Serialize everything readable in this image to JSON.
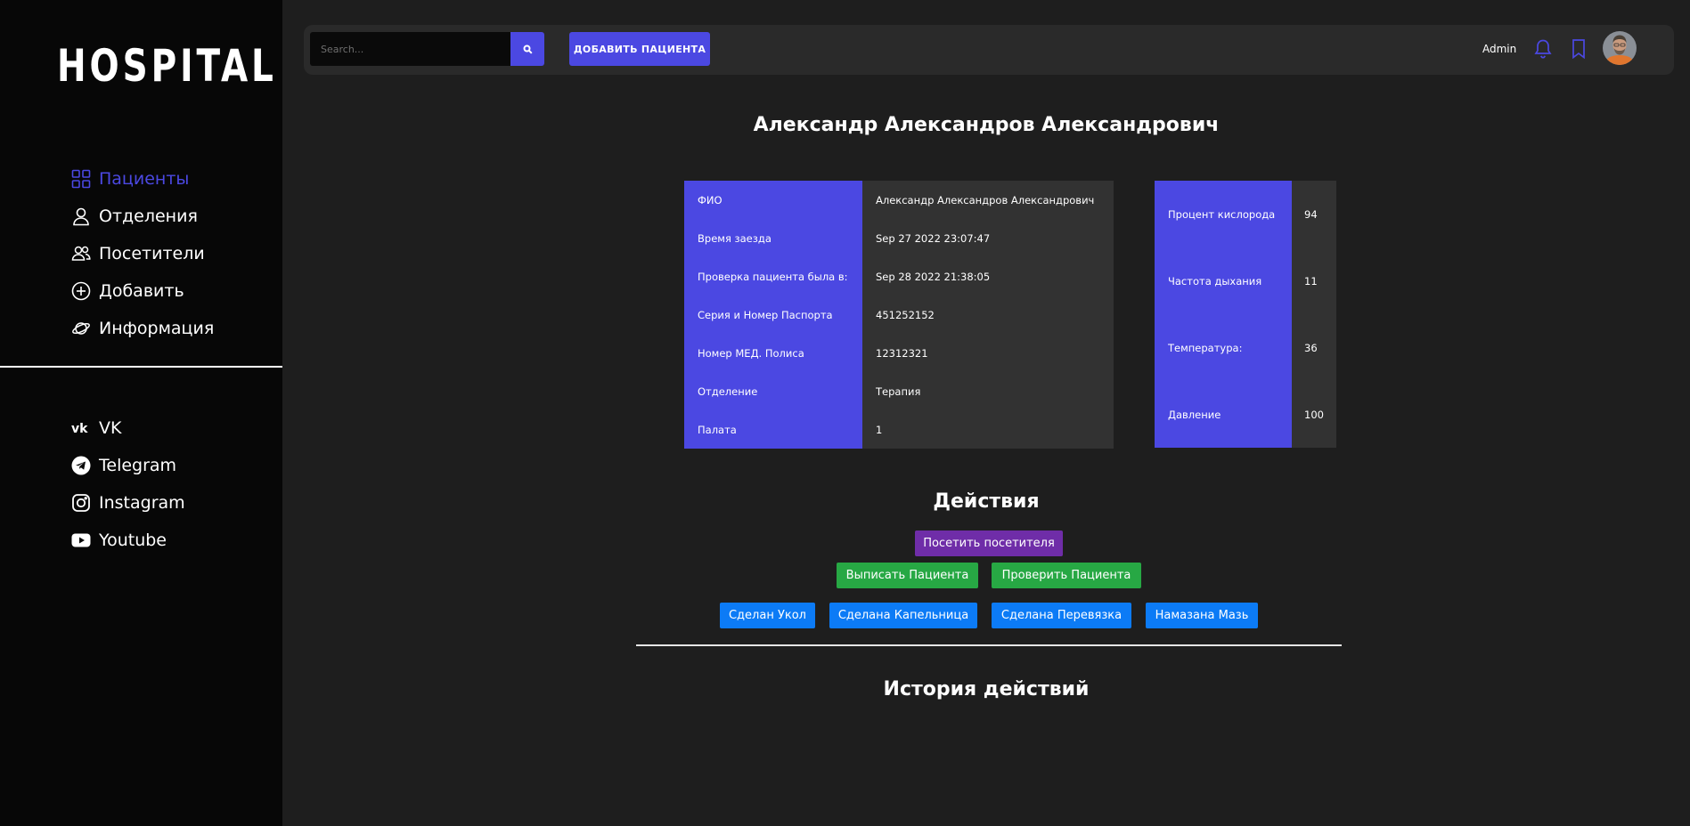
{
  "sidebar": {
    "logo": "HOSPITAL",
    "nav": [
      {
        "label": "Пациенты",
        "icon": "grid-icon",
        "active": true
      },
      {
        "label": "Отделения",
        "icon": "user-icon",
        "active": false
      },
      {
        "label": "Посетители",
        "icon": "users-icon",
        "active": false
      },
      {
        "label": "Добавить",
        "icon": "plus-circle-icon",
        "active": false
      },
      {
        "label": "Информация",
        "icon": "planet-icon",
        "active": false
      }
    ],
    "social": [
      {
        "label": "VK",
        "icon": "vk-icon"
      },
      {
        "label": "Telegram",
        "icon": "telegram-icon"
      },
      {
        "label": "Instagram",
        "icon": "instagram-icon"
      },
      {
        "label": "Youtube",
        "icon": "youtube-icon"
      }
    ]
  },
  "topbar": {
    "search_placeholder": "Search...",
    "add_patient_label": "ДОБАВИТЬ ПАЦИЕНТА",
    "user_name": "Admin"
  },
  "patient": {
    "title": "Александр Александров Александрович",
    "info": [
      {
        "key": "ФИО",
        "value": "Александр Александров Александрович"
      },
      {
        "key": "Время заезда",
        "value": "Sep 27 2022 23:07:47"
      },
      {
        "key": "Проверка пациента была в:",
        "value": "Sep 28 2022 21:38:05"
      },
      {
        "key": "Серия и Номер Паспорта",
        "value": "451252152"
      },
      {
        "key": "Номер МЕД. Полиса",
        "value": "12312321"
      },
      {
        "key": "Отделение",
        "value": "Терапия"
      },
      {
        "key": "Палата",
        "value": "1"
      }
    ],
    "vitals": [
      {
        "key": "Процент кислорода",
        "value": "94"
      },
      {
        "key": "Частота дыхания",
        "value": "11"
      },
      {
        "key": "Температура:",
        "value": "36"
      },
      {
        "key": "Давление",
        "value": "100"
      }
    ]
  },
  "actions": {
    "title": "Действия",
    "visit_label": "Посетить посетителя",
    "discharge_label": "Выписать Пациента",
    "check_label": "Проверить Пациента",
    "injection_label": "Сделан Укол",
    "drip_label": "Сделана Капельница",
    "bandage_label": "Сделана Перевязка",
    "ointment_label": "Намазана Мазь"
  },
  "history": {
    "title": "История действий"
  },
  "colors": {
    "accent": "#4b48e2",
    "purple": "#6f2da8",
    "green": "#27a844",
    "blue": "#0c7bf6"
  }
}
